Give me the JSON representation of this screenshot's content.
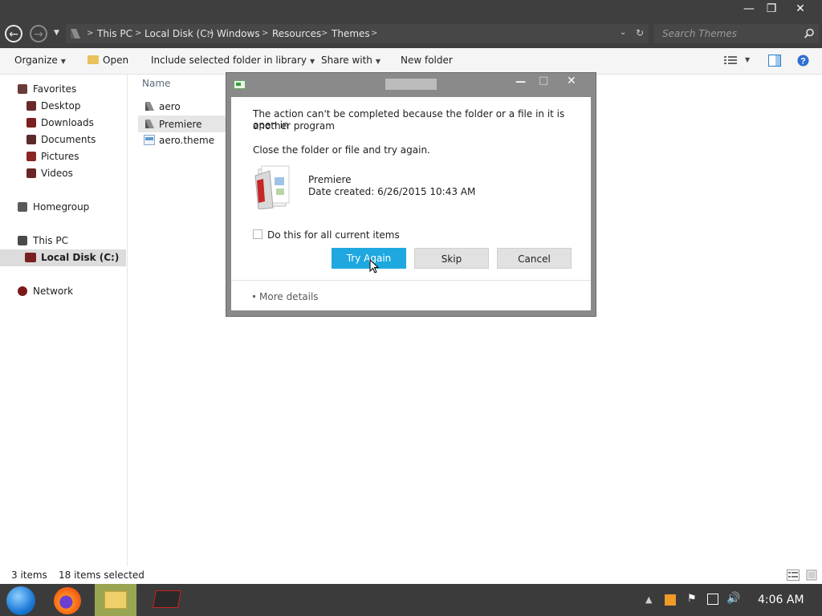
{
  "window": {
    "controls": {
      "minimize": "—",
      "maximize": "❐",
      "close": "✕"
    }
  },
  "address": {
    "back": "←",
    "forward": "→",
    "breadcrumbs": [
      "This PC",
      "Local Disk (C:)",
      "Windows",
      "Resources",
      "Themes"
    ],
    "search_placeholder": "Search Themes"
  },
  "toolbar": {
    "organize": "Organize",
    "open": "Open",
    "include": "Include selected folder in library",
    "share": "Share with",
    "new_folder": "New folder"
  },
  "nav": {
    "favorites": "Favorites",
    "desktop": "Desktop",
    "downloads": "Downloads",
    "documents": "Documents",
    "pictures": "Pictures",
    "videos": "Videos",
    "homegroup": "Homegroup",
    "thispc": "This PC",
    "localdisk": "Local Disk (C:)",
    "network": "Network"
  },
  "files": {
    "header_name": "Name",
    "items": [
      "aero",
      "Premiere",
      "aero.theme"
    ]
  },
  "dialog": {
    "message1": "The action can't be completed because the folder or a file in it is open in",
    "message2": "another program",
    "instruction": "Close the folder or file and try again.",
    "file_name": "Premiere",
    "date_created": "Date created: 6/26/2015 10:43 AM",
    "checkbox_label": "Do this for all current items",
    "try_again": "Try Again",
    "skip": "Skip",
    "cancel": "Cancel",
    "more_details": "More details",
    "minimize": "—",
    "maximize": "□",
    "close": "✕"
  },
  "status": {
    "items": "3 items",
    "selected": "18 items selected"
  },
  "taskbar": {
    "time": "4:06 AM"
  },
  "colors": {
    "accent": "#1fa8e0",
    "titlebar": "#3f3f3f",
    "taskbar": "#3b3b3b"
  }
}
